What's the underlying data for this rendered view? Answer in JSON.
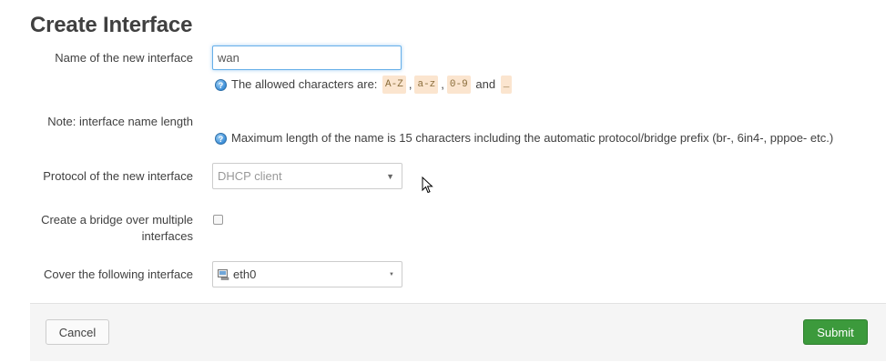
{
  "page": {
    "title": "Create Interface"
  },
  "fields": {
    "name": {
      "label": "Name of the new interface",
      "value": "wan",
      "hint_prefix": "The allowed characters are:",
      "allowed": [
        "A-Z",
        "a-z",
        "0-9",
        "_"
      ],
      "separator": ",",
      "and_word": "and"
    },
    "note": {
      "label": "Note: interface name length",
      "hint": "Maximum length of the name is 15 characters including the automatic protocol/bridge prefix (br-, 6in4-, pppoe- etc.)"
    },
    "protocol": {
      "label": "Protocol of the new interface",
      "selected": "DHCP client"
    },
    "bridge": {
      "label_line1": "Create a bridge over multiple",
      "label_line2": "interfaces",
      "checked": false
    },
    "cover": {
      "label": "Cover the following interface",
      "selected": "eth0",
      "icon": "ethernet-port-icon"
    }
  },
  "footer": {
    "cancel_label": "Cancel",
    "submit_label": "Submit",
    "submit_color": "#3c9a3c"
  },
  "icons": {
    "help": "help-icon",
    "caret": "caret-down-icon",
    "cursor": "mouse-pointer-icon"
  }
}
